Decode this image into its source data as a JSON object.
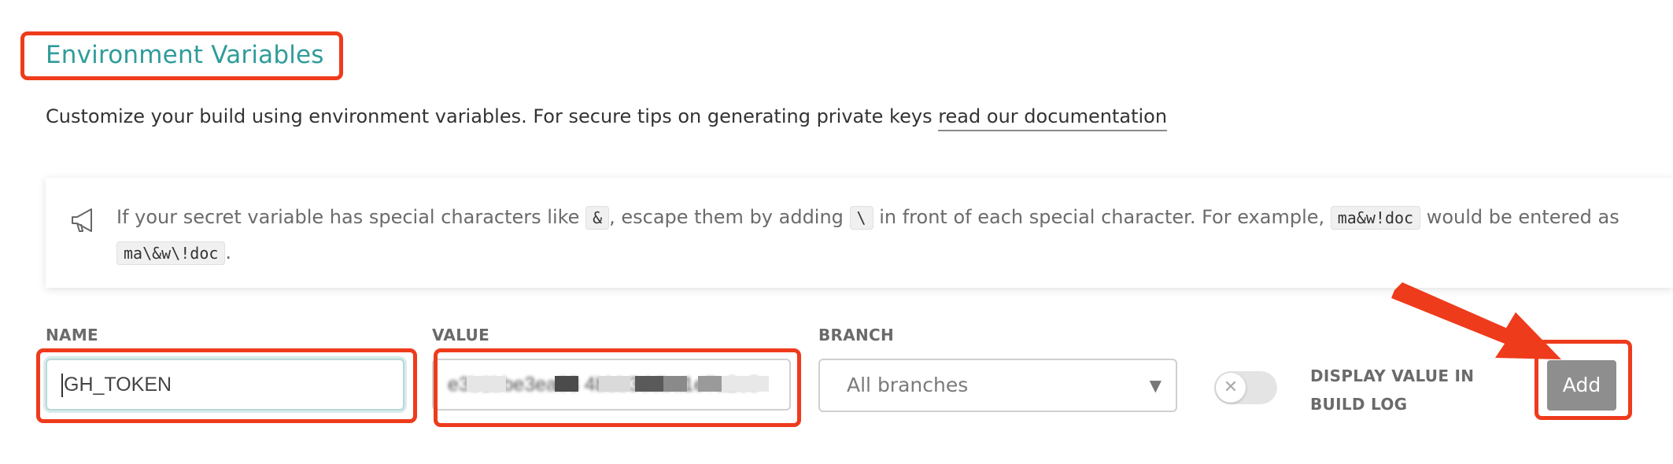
{
  "section": {
    "title": "Environment Variables"
  },
  "intro": {
    "text": "Customize your build using environment variables. For secure tips on generating private keys ",
    "link_label": "read our documentation"
  },
  "notice": {
    "icon": "megaphone-icon",
    "part1": "If your secret variable has special characters like ",
    "code1": "&",
    "part2": ", escape them by adding ",
    "code2": "\\",
    "part3": " in front of each special character. For example, ",
    "code3": "ma&w!doc",
    "part4": " would be entered as ",
    "code4": "ma\\&w\\!doc",
    "part5": "."
  },
  "form": {
    "name_label": "NAME",
    "name_value": "GH_TOKEN",
    "value_label": "VALUE",
    "value_value": "e3b1bbe3ea83 4bbb3ddba1e7a2e5",
    "branch_label": "BRANCH",
    "branch_selected": "All branches",
    "display_label_line1": "DISPLAY VALUE IN",
    "display_label_line2": "BUILD LOG",
    "display_toggle_on": false,
    "add_label": "Add"
  },
  "colors": {
    "title": "#2f9c9a",
    "highlight": "#ee3b1c",
    "button": "#8e8e8e"
  }
}
